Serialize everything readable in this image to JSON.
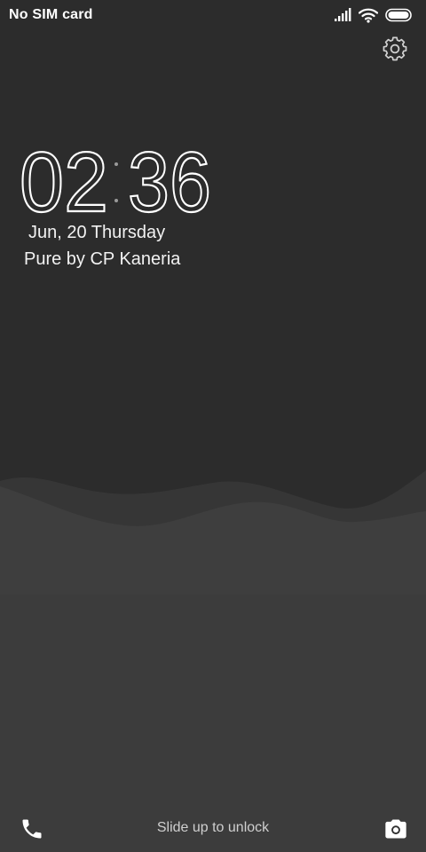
{
  "status_bar": {
    "carrier": "No SIM card",
    "icons": [
      "signal-icon",
      "wifi-icon",
      "battery-icon"
    ]
  },
  "lockscreen": {
    "clock": {
      "hours": "02",
      "minutes": "36"
    },
    "date": "Jun, 20 Thursday",
    "owner_info": "Pure by CP Kaneria"
  },
  "bottom": {
    "left_shortcut_icon": "phone-icon",
    "unlock_hint": "Slide up to unlock",
    "right_shortcut_icon": "camera-icon"
  },
  "colors": {
    "background": "#2c2c2c",
    "wave_back": "#383838",
    "wave_front": "#3e3e3e",
    "text": "#ffffff",
    "hint_text": "#cfcfcf"
  }
}
